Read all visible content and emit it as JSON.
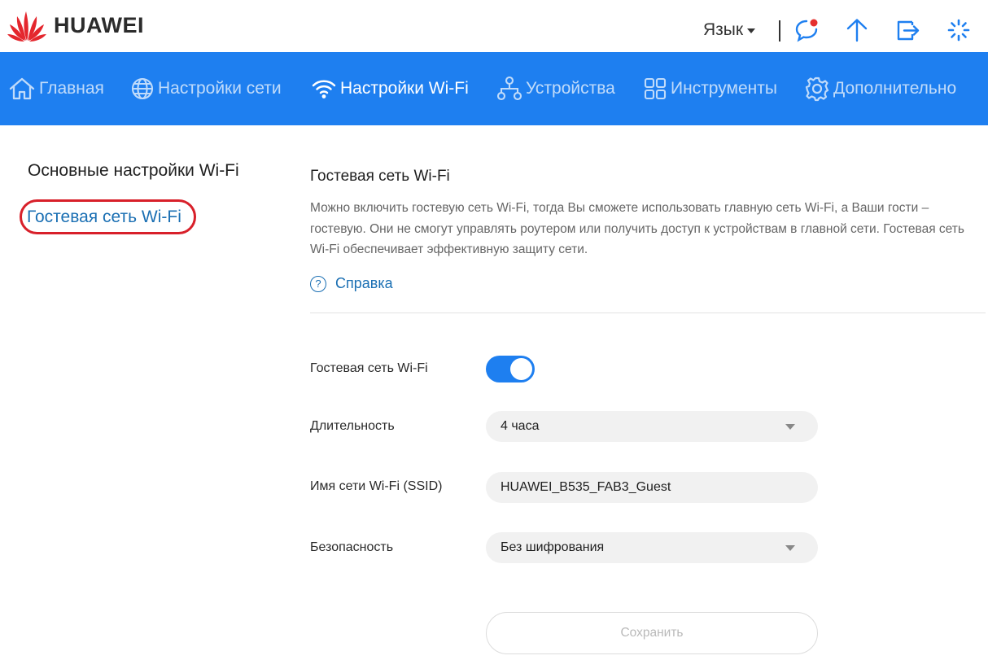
{
  "header": {
    "brand": "HUAWEI",
    "language_label": "Язык",
    "icons": [
      "message-icon",
      "upload-icon",
      "logout-icon",
      "loading-icon"
    ]
  },
  "nav": {
    "items": [
      {
        "label": "Главная",
        "icon": "home-icon",
        "active": false
      },
      {
        "label": "Настройки сети",
        "icon": "globe-icon",
        "active": false
      },
      {
        "label": "Настройки Wi-Fi",
        "icon": "wifi-icon",
        "active": true
      },
      {
        "label": "Устройства",
        "icon": "devices-icon",
        "active": false
      },
      {
        "label": "Инструменты",
        "icon": "tools-icon",
        "active": false
      },
      {
        "label": "Дополнительно",
        "icon": "gear-icon",
        "active": false
      }
    ]
  },
  "sidebar": {
    "items": [
      {
        "label": "Основные настройки Wi-Fi",
        "active": false
      },
      {
        "label": "Гостевая сеть Wi-Fi",
        "active": true
      }
    ]
  },
  "main": {
    "title": "Гостевая сеть Wi-Fi",
    "description": "Можно включить гостевую сеть Wi-Fi, тогда Вы сможете использовать главную сеть Wi-Fi, а Ваши гости – гостевую. Они не смогут управлять роутером или получить доступ к устройствам в главной сети. Гостевая сеть Wi-Fi обеспечивает эффективную защиту сети.",
    "help_label": "Справка",
    "guest_wifi": {
      "label": "Гостевая сеть Wi-Fi",
      "enabled": true
    },
    "duration": {
      "label": "Длительность",
      "value": "4 часа"
    },
    "ssid": {
      "label": "Имя сети Wi-Fi (SSID)",
      "value": "HUAWEI_B535_FAB3_Guest"
    },
    "security": {
      "label": "Безопасность",
      "value": "Без шифрования"
    },
    "save_label": "Сохранить"
  },
  "colors": {
    "nav_bg": "#1e7ff0",
    "link": "#1a6fb3",
    "highlight_oval": "#d8202a",
    "notification_dot": "#e5302e"
  }
}
